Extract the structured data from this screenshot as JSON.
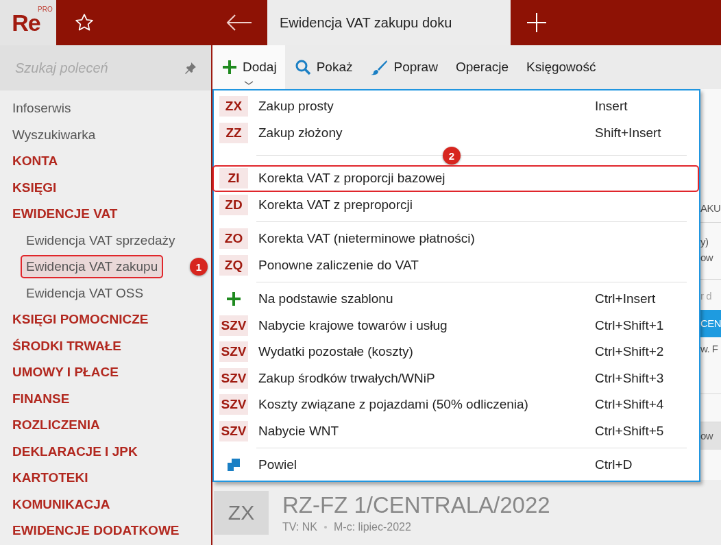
{
  "app": {
    "logo": "Re",
    "logo_badge": "PRO"
  },
  "tabs": [
    {
      "label": "Ewidencja VAT zakupu doku",
      "selected": true
    }
  ],
  "sidebar": {
    "search": {
      "placeholder": "Szukaj poleceń"
    },
    "items": [
      {
        "label": "Infoserwis",
        "kind": "link"
      },
      {
        "label": "Wyszukiwarka",
        "kind": "link"
      },
      {
        "label": "KONTA",
        "kind": "section"
      },
      {
        "label": "KSIĘGI",
        "kind": "section"
      },
      {
        "label": "EWIDENCJE VAT",
        "kind": "section",
        "children": [
          {
            "label": "Ewidencja VAT sprzedaży",
            "selected": false
          },
          {
            "label": "Ewidencja VAT zakupu",
            "selected": true,
            "callout": "1"
          },
          {
            "label": "Ewidencja VAT OSS",
            "selected": false
          }
        ]
      },
      {
        "label": "KSIĘGI POMOCNICZE",
        "kind": "section"
      },
      {
        "label": "ŚRODKI TRWAŁE",
        "kind": "section"
      },
      {
        "label": "UMOWY I PŁACE",
        "kind": "section"
      },
      {
        "label": "FINANSE",
        "kind": "section"
      },
      {
        "label": "ROZLICZENIA",
        "kind": "section"
      },
      {
        "label": "DEKLARACJE I JPK",
        "kind": "section"
      },
      {
        "label": "KARTOTEKI",
        "kind": "section"
      },
      {
        "label": "KOMUNIKACJA",
        "kind": "section"
      },
      {
        "label": "EWIDENCJE DODATKOWE",
        "kind": "section"
      }
    ]
  },
  "toolbar": [
    {
      "label": "Dodaj",
      "kind": "plus",
      "selected": true
    },
    {
      "label": "Pokaż",
      "kind": "search",
      "selected": false
    },
    {
      "label": "Popraw",
      "kind": "brush",
      "selected": false
    },
    {
      "label": "Operacje",
      "selected": false
    },
    {
      "label": "Księgowość",
      "selected": false
    }
  ],
  "menu": [
    [
      {
        "kind": "code",
        "code": "ZX",
        "label": "Zakup prosty",
        "shortcut": "Insert"
      },
      {
        "kind": "code",
        "code": "ZZ",
        "label": "Zakup złożony",
        "shortcut": "Shift+Insert"
      }
    ],
    [
      {
        "kind": "code",
        "code": "ZI",
        "label": "Korekta VAT z proporcji bazowej",
        "callout": "2"
      },
      {
        "kind": "code",
        "code": "ZD",
        "label": "Korekta VAT z preproporcji"
      }
    ],
    [
      {
        "kind": "code",
        "code": "ZO",
        "label": "Korekta VAT (nieterminowe płatności)"
      },
      {
        "kind": "code",
        "code": "ZQ",
        "label": "Ponowne zaliczenie do VAT"
      }
    ],
    [
      {
        "kind": "plus",
        "label": "Na podstawie szablonu",
        "shortcut": "Ctrl+Insert"
      },
      {
        "kind": "code",
        "code": "SZV",
        "label": "Nabycie krajowe towarów i usług",
        "shortcut": "Ctrl+Shift+1"
      },
      {
        "kind": "code",
        "code": "SZV",
        "label": "Wydatki pozostałe (koszty)",
        "shortcut": "Ctrl+Shift+2"
      },
      {
        "kind": "code",
        "code": "SZV",
        "label": "Zakup środków trwałych/WNiP",
        "shortcut": "Ctrl+Shift+3"
      },
      {
        "kind": "code",
        "code": "SZV",
        "label": "Koszty związane z pojazdami (50% odliczenia)",
        "shortcut": "Ctrl+Shift+4"
      },
      {
        "kind": "code",
        "code": "SZV",
        "label": "Nabycie WNT",
        "shortcut": "Ctrl+Shift+5"
      }
    ],
    [
      {
        "kind": "copy",
        "label": "Powiel",
        "shortcut": "Ctrl+D"
      }
    ]
  ],
  "background_fragments": [
    {
      "text": "AKU",
      "selected": false
    },
    {
      "text": "y)",
      "selected": false
    },
    {
      "text": "ow",
      "selected": false
    },
    {
      "text": "r d",
      "selected": false
    },
    {
      "text": "CEN",
      "selected": true
    },
    {
      "text": "w. F",
      "selected": false
    },
    {
      "text": "ow",
      "selected": false
    }
  ],
  "document": {
    "code": "ZX",
    "title": "RZ-FZ 1/CENTRALA/2022",
    "meta": [
      "TV: NK",
      "M-c: lipiec-2022"
    ]
  }
}
